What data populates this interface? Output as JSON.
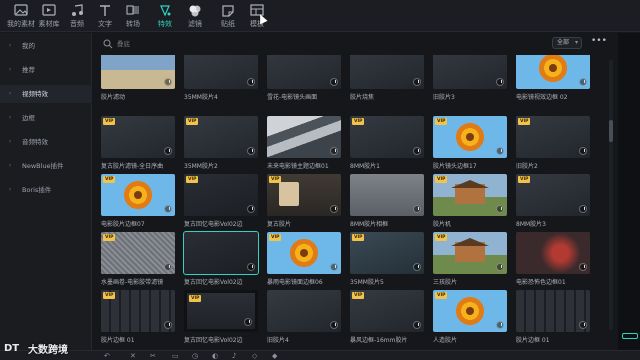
{
  "toolbar": {
    "tools": [
      {
        "label": "我的素材",
        "icon": "my-media-icon"
      },
      {
        "label": "素材库",
        "icon": "stock-library-icon"
      },
      {
        "label": "音频",
        "icon": "audio-icon"
      },
      {
        "label": "文字",
        "icon": "text-icon"
      },
      {
        "label": "转场",
        "icon": "transition-icon"
      },
      {
        "label": "特效",
        "icon": "effects-icon",
        "active": true
      },
      {
        "label": "滤镜",
        "icon": "filter-icon"
      },
      {
        "label": "贴纸",
        "icon": "sticker-icon"
      },
      {
        "label": "模板",
        "icon": "template-icon"
      }
    ]
  },
  "sidebar": {
    "items": [
      {
        "label": "我的"
      },
      {
        "label": "推荐"
      },
      {
        "label": "视频特效",
        "active": true
      },
      {
        "label": "边框"
      },
      {
        "label": "音频特效"
      },
      {
        "label": "NewBlue插件"
      },
      {
        "label": "Boris插件"
      }
    ]
  },
  "search": {
    "placeholder": "叠底"
  },
  "filter": {
    "selected": "全部"
  },
  "more_label": "•••",
  "cards": [
    {
      "caption": "胶片滤动",
      "thumb": "t-beach",
      "vip": false
    },
    {
      "caption": "35MM胶片4",
      "thumb": "t-dark",
      "vip": false
    },
    {
      "caption": "雪花-电影镜头画面",
      "thumb": "t-dark",
      "vip": false
    },
    {
      "caption": "胶片烧焦",
      "thumb": "t-dark",
      "vip": false
    },
    {
      "caption": "旧胶片3",
      "thumb": "t-dark",
      "vip": false
    },
    {
      "caption": "电影镜视效边框 02",
      "thumb": "t-flower",
      "vip": false
    },
    {
      "caption": "复古胶片滤镜-全日序曲",
      "thumb": "t-dark",
      "vip": true
    },
    {
      "caption": "35MM胶片2",
      "thumb": "t-dark",
      "vip": true
    },
    {
      "caption": "未来电影镜主题边框01",
      "thumb": "t-diag",
      "vip": false
    },
    {
      "caption": "8MM胶片1",
      "thumb": "t-dark",
      "vip": true
    },
    {
      "caption": "胶片镜头边框17",
      "thumb": "t-flower",
      "vip": true
    },
    {
      "caption": "旧胶片2",
      "thumb": "t-dark",
      "vip": true
    },
    {
      "caption": "电影胶片边框07",
      "thumb": "t-flower",
      "vip": true
    },
    {
      "caption": "复古回忆电影Vol02边",
      "thumb": "t-darker",
      "vip": true
    },
    {
      "caption": "复古胶片",
      "thumb": "t-room",
      "vip": true
    },
    {
      "caption": "8MM胶片相框",
      "thumb": "t-gray",
      "vip": false
    },
    {
      "caption": "胶片机",
      "thumb": "t-house",
      "vip": true
    },
    {
      "caption": "8MM胶片3",
      "thumb": "t-dark",
      "vip": true
    },
    {
      "caption": "水墨画卷-电影胶带滤镜",
      "thumb": "t-noise",
      "vip": true
    },
    {
      "caption": "复古回忆电影Vol02边",
      "thumb": "t-darker",
      "vip": false,
      "selected": true
    },
    {
      "caption": "暴雨电影镜面边框06",
      "thumb": "t-flower",
      "vip": true
    },
    {
      "caption": "35MM胶片5",
      "thumb": "t-teal",
      "vip": true
    },
    {
      "caption": "三孩胶片",
      "thumb": "t-house",
      "vip": true
    },
    {
      "caption": "电影恐怖色边框01",
      "thumb": "t-red",
      "vip": false
    },
    {
      "caption": "胶片边框 01",
      "thumb": "t-film",
      "vip": true
    },
    {
      "caption": "复古回忆电影Vol02边",
      "thumb": "t-blank-frame",
      "vip": true
    },
    {
      "caption": "旧胶片4",
      "thumb": "t-dark",
      "vip": false
    },
    {
      "caption": "暴风边框-16mm胶片",
      "thumb": "t-dark",
      "vip": true
    },
    {
      "caption": "人造胶片",
      "thumb": "t-flower",
      "vip": true
    },
    {
      "caption": "胶片边框 01",
      "thumb": "t-film",
      "vip": false
    }
  ],
  "watermark": {
    "text": "大数跨境",
    "logo_text": "DT"
  },
  "colors": {
    "accent": "#2fd3c2",
    "vip": "#f1c24c",
    "bg": "#15171b"
  }
}
